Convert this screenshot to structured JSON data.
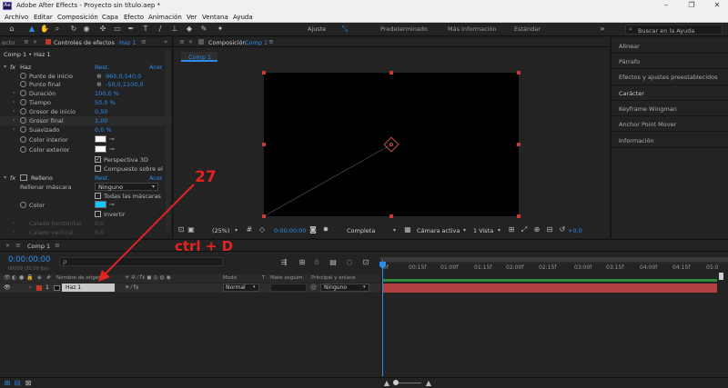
{
  "window": {
    "title": "Adobe After Effects - Proyecto sin título.aep *",
    "logo": "Ae"
  },
  "menu": [
    "Archivo",
    "Editar",
    "Composición",
    "Capa",
    "Efecto",
    "Animación",
    "Ver",
    "Ventana",
    "Ayuda"
  ],
  "toolbar": {
    "ajuste_label": "Ajuste",
    "workspaces": [
      "Predeterminado",
      "Más información",
      "Estándar"
    ],
    "search_placeholder": "Buscar en la Ayuda"
  },
  "effects_panel": {
    "tab_prefix": "ecto",
    "tab_title": "Controles de efectos",
    "tab_layer": "Haz 1",
    "breadcrumb": "Comp 1 • Haz 1",
    "effects": [
      {
        "name": "Haz",
        "reset": "Rest.",
        "about": "Acer",
        "props": [
          {
            "label": "Punto de inicio",
            "value": "960,0,540,0",
            "point": true
          },
          {
            "label": "Punto final",
            "value": "-50,0,1100,0",
            "point": true
          },
          {
            "label": "Duración",
            "value": "100,0 %"
          },
          {
            "label": "Tiempo",
            "value": "50,0 %"
          },
          {
            "label": "Grosor de inicio",
            "value": "0,50"
          },
          {
            "label": "Grosor final",
            "value": "1,00"
          },
          {
            "label": "Suavizado",
            "value": "0,0 %"
          },
          {
            "label": "Color interior",
            "swatch": "#ffffff"
          },
          {
            "label": "Color exterior",
            "swatch": "#ffffff"
          }
        ],
        "checks": [
          {
            "label": "Perspectiva 3D",
            "checked": true
          },
          {
            "label": "Compuesto sobre el",
            "checked": false
          }
        ]
      },
      {
        "name": "Relleno",
        "reset": "Rest.",
        "about": "Acer",
        "props": [
          {
            "label": "Rellenar máscara",
            "dropdown": "Ninguno"
          },
          {
            "label": "Todas las máscaras",
            "checkbox": true
          },
          {
            "label": "Color",
            "swatch": "#14c8ff"
          },
          {
            "label": "Invertir",
            "checkbox": true
          },
          {
            "label": "Calado horizontal",
            "value": "0,0",
            "disabled": true
          },
          {
            "label": "Calado vertical",
            "value": "0,0",
            "disabled": true
          }
        ]
      }
    ]
  },
  "comp_panel": {
    "tab_title": "Composición",
    "tab_comp": "Comp 1",
    "subtab": "Comp 1",
    "zoom": "(25%)",
    "timecode": "0:00:00:00",
    "resolution": "Completa",
    "camera": "Cámara activa",
    "views": "1 Vista",
    "exposure": "+0,0"
  },
  "right_panel": {
    "items": [
      "Alinear",
      "Párrafo",
      "Efectos y ajustes preestablecidos",
      "Carácter",
      "Keyframe Wingman",
      "Anchor Point Mover",
      "Información"
    ]
  },
  "timeline": {
    "tab": "Comp 1",
    "current_time": "0:00:00:00",
    "frame_info": "00000 (30.00 fps)",
    "search_icon": "ρ",
    "columns": {
      "source_name": "Nombre de origen",
      "mode": "Modo",
      "t": "T",
      "track_matte": "Mate seguim.",
      "parent": "Principal y enlace"
    },
    "layers": [
      {
        "index": "1",
        "name": "Haz 1",
        "mode": "Normal",
        "parent": "Ninguno",
        "color": "#c0392b"
      }
    ],
    "ruler": [
      "0f",
      "00:15f",
      "01:00f",
      "01:15f",
      "02:00f",
      "02:15f",
      "03:00f",
      "03:15f",
      "04:00f",
      "04:15f",
      "05:0"
    ]
  },
  "annotations": {
    "step_number": "27",
    "shortcut": "ctrl + D",
    "color": "#e32222"
  }
}
